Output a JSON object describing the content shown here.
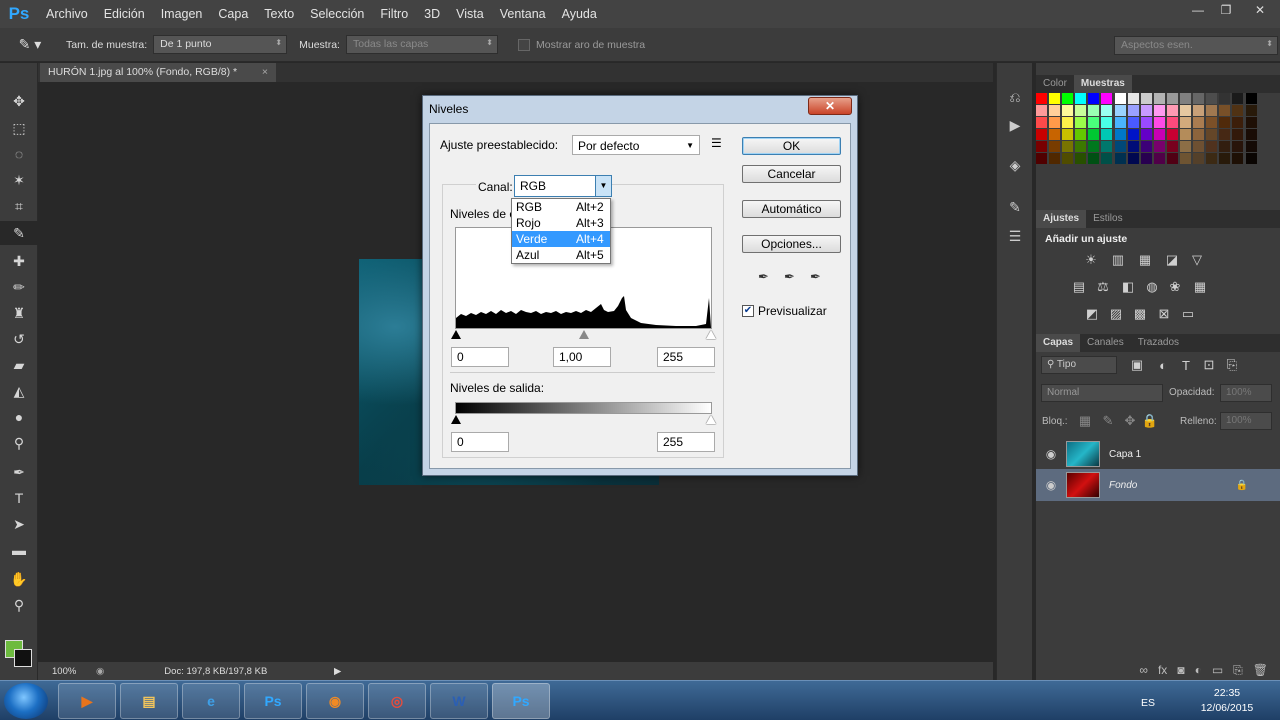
{
  "app": {
    "logo": "Ps",
    "menu": [
      "Archivo",
      "Edición",
      "Imagen",
      "Capa",
      "Texto",
      "Selección",
      "Filtro",
      "3D",
      "Vista",
      "Ventana",
      "Ayuda"
    ],
    "window_controls": {
      "minimize": "—",
      "restore": "❐",
      "close": "✕"
    }
  },
  "options_bar": {
    "sample_size_label": "Tam. de muestra:",
    "sample_size_value": "De 1 punto",
    "sample_label": "Muestra:",
    "sample_value": "Todas las capas",
    "show_ring_label": "Mostrar aro de muestra",
    "workspace": "Aspectos esen."
  },
  "document": {
    "tab_title": "HURÓN 1.jpg al 100% (Fondo, RGB/8) *",
    "zoom": "100%",
    "doc_size": "Doc: 197,8 KB/197,8 KB"
  },
  "dialog": {
    "title": "Niveles",
    "preset_label": "Ajuste preestablecido:",
    "preset_value": "Por defecto",
    "channel_label": "Canal:",
    "channel_value": "RGB",
    "input_levels_label": "Niveles de e",
    "input_black": "0",
    "input_gamma": "1,00",
    "input_white": "255",
    "output_levels_label": "Niveles de salida:",
    "output_black": "0",
    "output_white": "255",
    "buttons": {
      "ok": "OK",
      "cancel": "Cancelar",
      "auto": "Automático",
      "options": "Opciones..."
    },
    "preview_label": "Previsualizar",
    "preview_checked": true,
    "channel_options": [
      {
        "name": "RGB",
        "shortcut": "Alt+2"
      },
      {
        "name": "Rojo",
        "shortcut": "Alt+3"
      },
      {
        "name": "Verde",
        "shortcut": "Alt+4"
      },
      {
        "name": "Azul",
        "shortcut": "Alt+5"
      }
    ],
    "highlighted_option": "Verde"
  },
  "panels": {
    "color_tabs": [
      "Color",
      "Muestras"
    ],
    "adjust_tabs": [
      "Ajustes",
      "Estilos"
    ],
    "adjust_title": "Añadir un ajuste",
    "layer_tabs": [
      "Capas",
      "Canales",
      "Trazados"
    ],
    "filter_kind": "Tipo",
    "blend_mode": "Normal",
    "opacity_label": "Opacidad:",
    "opacity_value": "100%",
    "lock_label": "Bloq.:",
    "fill_label": "Relleno:",
    "fill_value": "100%",
    "layers": [
      {
        "name": "Capa 1",
        "selected": false,
        "locked": false
      },
      {
        "name": "Fondo",
        "selected": true,
        "locked": true
      }
    ]
  },
  "swatches": [
    "#ff0000",
    "#ffff00",
    "#00ff00",
    "#00ffff",
    "#0000ff",
    "#ff00ff",
    "#ffffff",
    "#e6e6e6",
    "#cccccc",
    "#b3b3b3",
    "#999999",
    "#808080",
    "#666666",
    "#4d4d4d",
    "#333333",
    "#1a1a1a",
    "#000000"
  ],
  "taskbar": {
    "language": "ES",
    "time": "22:35",
    "date": "12/06/2015",
    "apps": [
      {
        "id": "media-player",
        "glyph": "▶",
        "color": "#e8741c"
      },
      {
        "id": "explorer",
        "glyph": "▤",
        "color": "#f2c55c"
      },
      {
        "id": "ie",
        "glyph": "e",
        "color": "#3ea0e8"
      },
      {
        "id": "photoshop-1",
        "glyph": "Ps",
        "color": "#31a8ff"
      },
      {
        "id": "firefox",
        "glyph": "◉",
        "color": "#f08a24"
      },
      {
        "id": "chrome",
        "glyph": "◎",
        "color": "#e74c3c"
      },
      {
        "id": "word",
        "glyph": "W",
        "color": "#2b5fb4"
      },
      {
        "id": "photoshop-2",
        "glyph": "Ps",
        "color": "#31a8ff"
      }
    ]
  },
  "colors": {
    "accent": "#31a8ff",
    "selection": "#3399ff",
    "fg": "#6dbb3f",
    "bg": "#111111"
  }
}
